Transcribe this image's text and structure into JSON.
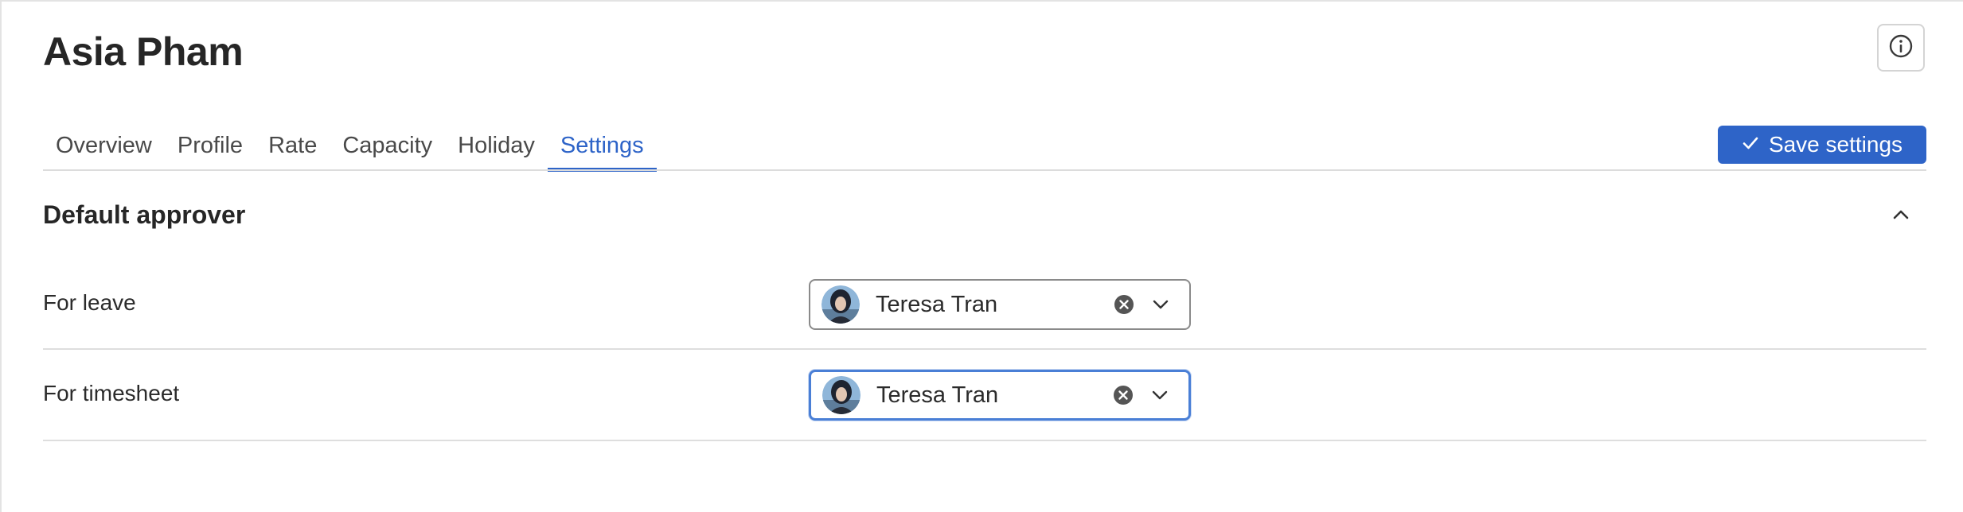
{
  "page": {
    "title": "Asia Pham",
    "info_icon": "info-circle-icon"
  },
  "tabs": [
    {
      "label": "Overview",
      "active": false
    },
    {
      "label": "Profile",
      "active": false
    },
    {
      "label": "Rate",
      "active": false
    },
    {
      "label": "Capacity",
      "active": false
    },
    {
      "label": "Holiday",
      "active": false
    },
    {
      "label": "Settings",
      "active": true
    }
  ],
  "toolbar": {
    "save_label": "Save settings",
    "save_icon": "check-icon"
  },
  "section": {
    "title": "Default approver",
    "collapse_icon": "chevron-up-icon",
    "expanded": true
  },
  "rows": [
    {
      "label": "For leave",
      "value": "Teresa Tran",
      "focused": false
    },
    {
      "label": "For timesheet",
      "value": "Teresa Tran",
      "focused": true
    }
  ],
  "colors": {
    "accent": "#2e64c8",
    "focus_border": "#4a7fd6",
    "text": "#2b2b2b",
    "divider": "#dedede"
  }
}
